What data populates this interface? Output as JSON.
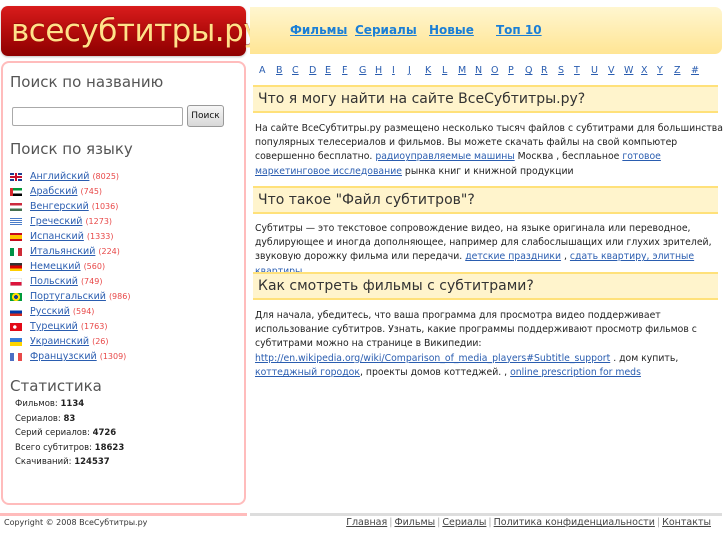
{
  "logo": {
    "text": "всесубтитры.ру"
  },
  "topnav": {
    "items": [
      {
        "label": "Фильмы"
      },
      {
        "label": "Сериалы"
      },
      {
        "label": "Новые"
      },
      {
        "label": "Топ 10"
      }
    ]
  },
  "sidebar": {
    "search_heading": "Поиск по названию",
    "search_input": {
      "value": "",
      "placeholder": ""
    },
    "search_button": "Поиск",
    "language_heading": "Поиск по языку",
    "languages": [
      {
        "name": "Английский",
        "count": "(8025)",
        "flag": "uk-flag"
      },
      {
        "name": "Арабский",
        "count": "(745)",
        "flag": "uae-flag"
      },
      {
        "name": "Венгерский",
        "count": "(1036)",
        "flag": "hungary-flag"
      },
      {
        "name": "Греческий",
        "count": "(1273)",
        "flag": "greece-flag"
      },
      {
        "name": "Испанский",
        "count": "(1333)",
        "flag": "spain-flag"
      },
      {
        "name": "Итальянский",
        "count": "(224)",
        "flag": "italy-flag"
      },
      {
        "name": "Немецкий",
        "count": "(560)",
        "flag": "germany-flag"
      },
      {
        "name": "Польский",
        "count": "(749)",
        "flag": "poland-flag"
      },
      {
        "name": "Португальский",
        "count": "(986)",
        "flag": "brazil-flag"
      },
      {
        "name": "Русский",
        "count": "(594)",
        "flag": "russia-flag"
      },
      {
        "name": "Турецкий",
        "count": "(1763)",
        "flag": "turkey-flag"
      },
      {
        "name": "Украинский",
        "count": "(26)",
        "flag": "ukraine-flag"
      },
      {
        "name": "Французский",
        "count": "(1309)",
        "flag": "france-flag"
      }
    ],
    "stats_heading": "Статистика",
    "stats": [
      {
        "label": "Фильмов:",
        "value": "1134"
      },
      {
        "label": "Сериалов:",
        "value": "83"
      },
      {
        "label": "Серий сериалов:",
        "value": "4726"
      },
      {
        "label": "Всего субтитров:",
        "value": "18623"
      },
      {
        "label": "Скачиваний:",
        "value": "124537"
      }
    ]
  },
  "alphabet": [
    "A",
    "B",
    "C",
    "D",
    "E",
    "F",
    "G",
    "H",
    "I",
    "J",
    "K",
    "L",
    "M",
    "N",
    "O",
    "P",
    "Q",
    "R",
    "S",
    "T",
    "U",
    "V",
    "W",
    "X",
    "Y",
    "Z",
    "#"
  ],
  "sections": [
    {
      "heading": "Что я могу найти на сайте ВсеСубтитры.ру?",
      "text1": "На сайте ВсеСубтитры.ру размещено несколько тысяч файлов с субтитрами для большинства популярных телесериалов и фильмов. Вы можете скачать файлы на свой компьютер совершенно бесплатно. ",
      "link1": "радиоуправляемые машины",
      "text2": " Москва , бесплаьное ",
      "link2": "готовое маркетинговое исследование",
      "text3": " рынка книг и книжной продукции"
    },
    {
      "heading": "Что такое \"Файл субтитров\"?",
      "text1": "Субтитры — это текстовое сопровождение видео, на языке оригинала или переводное, дублирующее и иногда дополняющее, например для слабослышащих или глухих зрителей, звуковую дорожку фильма или передачи. ",
      "link1": "детские праздники",
      "text2": " , ",
      "link2": "сдать квартиру, элитные квартиры"
    },
    {
      "heading": "Как смотреть фильмы с субтитрами?",
      "text1": "Для начала, убедитесь, что ваша программа для просмотра видео поддерживает использование субтитров. Узнать, какие программы поддерживают просмотр фильмов с субтитрами можно на странице в Википедии: ",
      "link1": "http://en.wikipedia.org/wiki/Comparison_of_media_players#Subtitle_support",
      "text2": " . дом купить, ",
      "link2": "коттеджный городок",
      "text3": ", проекты домов коттеджей. , ",
      "link3": "online prescription for meds"
    }
  ],
  "footer": {
    "copyright": "Copyright © 2008 ВсеСубтитры.ру",
    "links": [
      "Главная",
      "Фильмы",
      "Сериалы",
      "Политика конфиденциальности",
      "Контакты"
    ]
  }
}
